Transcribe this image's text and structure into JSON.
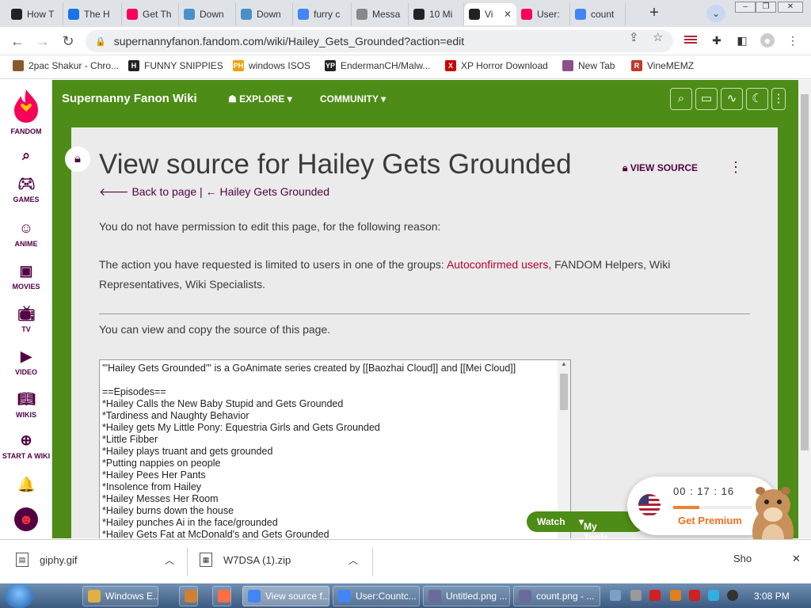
{
  "browser": {
    "tabs": [
      {
        "label": "How T",
        "icon": "terminal-icon",
        "color": "#222222"
      },
      {
        "label": "The H",
        "icon": "aol-icon",
        "color": "#1a73e8"
      },
      {
        "label": "Get Th",
        "icon": "fandom-icon",
        "color": "#fa005a"
      },
      {
        "label": "Down",
        "icon": "site-icon",
        "color": "#4a90c8"
      },
      {
        "label": "Down",
        "icon": "site-icon",
        "color": "#4a90c8"
      },
      {
        "label": "furry c",
        "icon": "google-icon",
        "color": "#4285f4"
      },
      {
        "label": "Messa",
        "icon": "site-icon",
        "color": "#888888"
      },
      {
        "label": "10 Mi",
        "icon": "ten-icon",
        "color": "#222222"
      },
      {
        "label": "Vi",
        "icon": "info-icon",
        "color": "#222222",
        "active": true
      },
      {
        "label": "User:",
        "icon": "fandom-icon",
        "color": "#fa005a"
      },
      {
        "label": "count",
        "icon": "google-icon",
        "color": "#4285f4"
      }
    ],
    "url": "supernannyfanon.fandom.com/wiki/Hailey_Gets_Grounded?action=edit",
    "bookmarks": [
      {
        "label": "2pac Shakur - Chro...",
        "color": "#8b5a2b",
        "glyph": ""
      },
      {
        "label": "FUNNY SNIPPIES",
        "color": "#222222",
        "glyph": "H"
      },
      {
        "label": "windows ISOS",
        "color": "#f0a000",
        "glyph": "PH"
      },
      {
        "label": "EndermanCH/Malw...",
        "color": "#222222",
        "glyph": "YP"
      },
      {
        "label": "XP Horror Download",
        "color": "#cc0000",
        "glyph": "X"
      },
      {
        "label": "New Tab",
        "color": "#8b4f8b",
        "glyph": ""
      },
      {
        "label": "VineMEMZ",
        "color": "#c0392b",
        "glyph": "R"
      }
    ]
  },
  "fandom": {
    "logo_label": "FANDOM",
    "rail": [
      {
        "label": "",
        "icon": "search-icon"
      },
      {
        "label": "GAMES",
        "icon": "gamepad-icon"
      },
      {
        "label": "ANIME",
        "icon": "anime-icon"
      },
      {
        "label": "MOVIES",
        "icon": "movies-icon"
      },
      {
        "label": "TV",
        "icon": "tv-icon"
      },
      {
        "label": "VIDEO",
        "icon": "video-icon"
      },
      {
        "label": "WIKIS",
        "icon": "book-icon"
      },
      {
        "label": "START A WIKI",
        "icon": "plus-icon"
      }
    ],
    "wiki_name": "Supernanny Fanon Wiki",
    "explore": "EXPLORE",
    "community": "COMMUNITY",
    "accent": "#4d8c16",
    "brand": "#520044"
  },
  "article": {
    "title": "View source for Hailey Gets Grounded",
    "view_source": "VIEW SOURCE",
    "back_link": "Back to page | ← Hailey Gets Grounded",
    "para1": "You do not have permission to edit this page, for the following reason:",
    "para2_pre": "The action you have requested is limited to users in one of the groups: ",
    "para2_link": "Autoconfirmed users",
    "para2_post": ", FANDOM Helpers, Wiki Representatives, Wiki Specialists.",
    "para3": "You can view and copy the source of this page.",
    "source_lines": [
      "'''Hailey Gets Grounded''' is a GoAnimate series created by [[Baozhai Cloud]] and [[Mei Cloud]]",
      "",
      "==Episodes==",
      "*Hailey Calls the New Baby Stupid and Gets Grounded",
      "*Tardiness and Naughty Behavior",
      "*Hailey gets My Little Pony: Equestria Girls and Gets Grounded",
      "*Little Fibber",
      "*Hailey plays truant and gets grounded",
      "*Putting nappies on people",
      "*Hailey Pees Her Pants",
      "*Insolence from Hailey",
      "*Hailey Messes Her Room",
      "*Hailey burns down the house",
      "*Hailey punches Ai in the face/grounded",
      "*Hailey Gets Fat at McDonald's and Gets Grounded"
    ],
    "watch": "Watch",
    "my_tools": "My Tools"
  },
  "widget": {
    "timer": "00 : 17 : 16",
    "get_premium": "Get Premium",
    "progress": 0.33
  },
  "downloads": [
    {
      "name": "giphy.gif"
    },
    {
      "name": "W7DSA (1).zip"
    }
  ],
  "downloads_show": "Sho",
  "taskbar": {
    "items": [
      {
        "label": "Windows E...",
        "color": "#e0b040"
      },
      {
        "label": "",
        "color": "#d08030"
      },
      {
        "label": "",
        "color": "#ff7040"
      },
      {
        "label": "View source f...",
        "color": "#4285f4",
        "active": true
      },
      {
        "label": "User:Countc...",
        "color": "#4285f4"
      },
      {
        "label": "Untitled.png ...",
        "color": "#6a6a9a"
      },
      {
        "label": "count.png - ...",
        "color": "#6a6a9a"
      }
    ],
    "clock": "3:08 PM"
  }
}
